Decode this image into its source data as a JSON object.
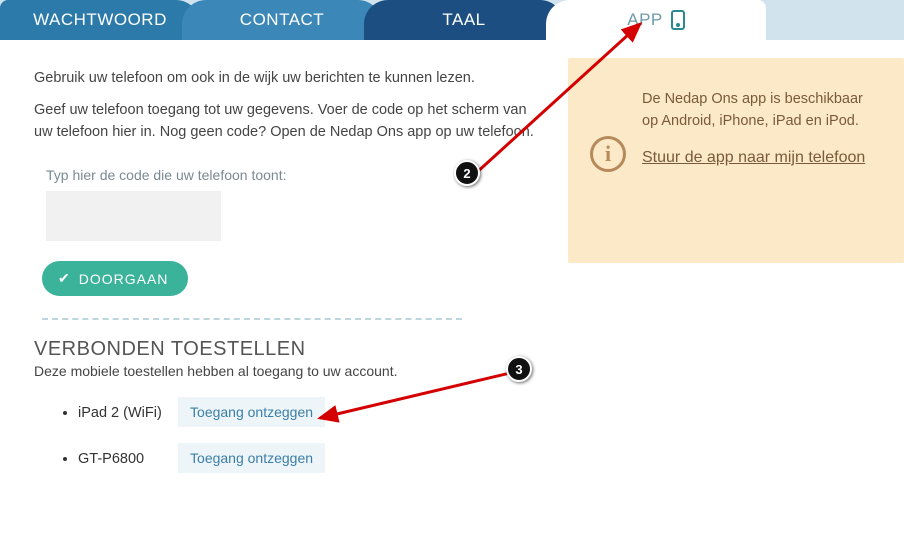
{
  "tabs": {
    "wachtwoord": "WACHTWOORD",
    "contact": "CONTACT",
    "taal": "TAAL",
    "app": "APP"
  },
  "intro": {
    "line1": "Gebruik uw telefoon om ook in de wijk uw berichten te kunnen lezen.",
    "line2": "Geef uw telefoon toegang tot uw gegevens. Voer de code op het scherm van uw telefoon hier in. Nog geen code? Open de Nedap Ons app op uw telefoon."
  },
  "code": {
    "label": "Typ hier de code die uw telefoon toont:",
    "value": ""
  },
  "continue_label": "DOORGAAN",
  "connected": {
    "title": "VERBONDEN TOESTELLEN",
    "subtitle": "Deze mobiele toestellen hebben al toegang to uw account.",
    "revoke_label": "Toegang ontzeggen",
    "devices": [
      {
        "name": "iPad 2 (WiFi)"
      },
      {
        "name": "GT-P6800"
      }
    ]
  },
  "info": {
    "text": "De Nedap Ons app is beschikbaar op Android, iPhone, iPad en iPod.",
    "link": "Stuur de app naar mijn telefoon"
  },
  "annotations": {
    "b2": "2",
    "b3": "3"
  }
}
